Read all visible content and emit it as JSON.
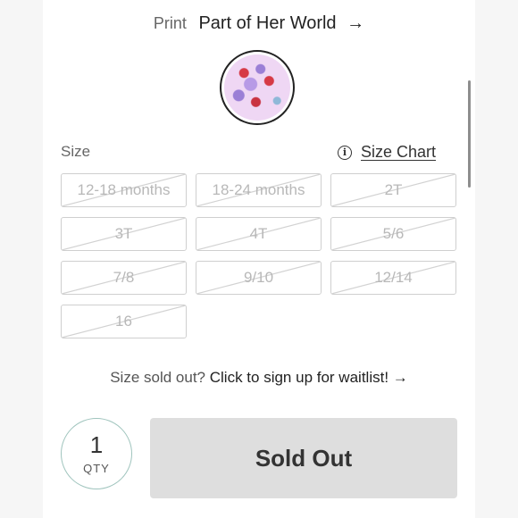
{
  "print": {
    "label": "Print",
    "name": "Part of Her World",
    "arrow": "→"
  },
  "swatch": {
    "icon": "print-swatch-image"
  },
  "size": {
    "label": "Size",
    "chart_label": "Size Chart",
    "options": [
      "12-18 months",
      "18-24 months",
      "2T",
      "3T",
      "4T",
      "5/6",
      "7/8",
      "9/10",
      "12/14",
      "16"
    ],
    "sold_out": true
  },
  "waitlist": {
    "prefix": "Size sold out?",
    "link": "Click to sign up for waitlist!",
    "arrow": "→"
  },
  "quantity": {
    "value": "1",
    "label": "QTY"
  },
  "purchase": {
    "button_label": "Sold Out"
  },
  "colors": {
    "accent_ring": "#9fc4bd",
    "disabled_text": "#b8b8b8",
    "button_bg": "#dedede"
  }
}
